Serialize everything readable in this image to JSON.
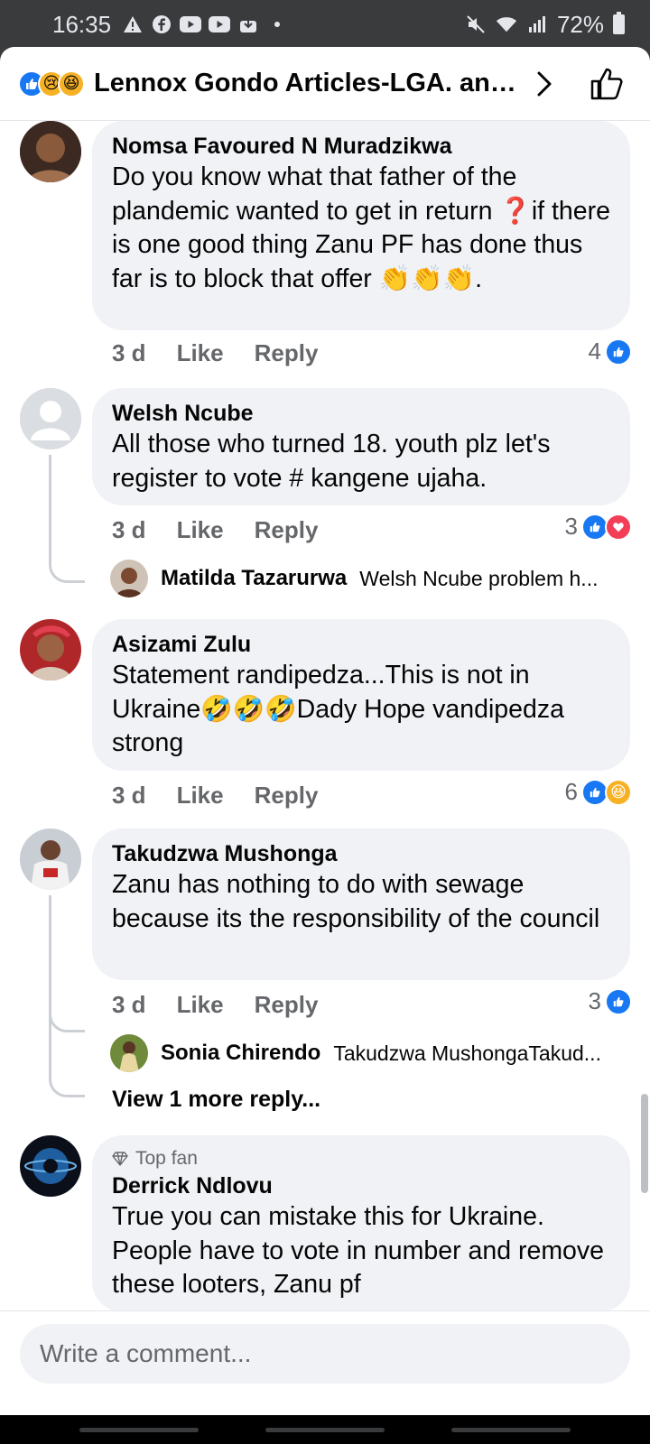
{
  "status": {
    "time": "16:35",
    "battery": "72%"
  },
  "header": {
    "title": "Lennox Gondo Articles-LGA. and..."
  },
  "comments": [
    {
      "author": "Nomsa Favoured N Muradzikwa",
      "text": "Do you know what that father  of  the plandemic  wanted to  get in return  ❓if there is one good  thing Zanu PF has done thus far is to block  that offer 👏👏👏.",
      "time": "3 d",
      "like": "Like",
      "reply": "Reply",
      "reactions": "4"
    },
    {
      "author": "Welsh Ncube",
      "text": "All those who turned 18. youth plz let's register to vote # kangene ujaha.",
      "time": "3 d",
      "like": "Like",
      "reply": "Reply",
      "reactions": "3",
      "reply_preview": {
        "author": "Matilda Tazarurwa",
        "snippet": "Welsh Ncube problem h..."
      }
    },
    {
      "author": "Asizami Zulu",
      "text": "Statement randipedza...This is not in Ukraine🤣🤣🤣Dady Hope vandipedza strong",
      "time": "3 d",
      "like": "Like",
      "reply": "Reply",
      "reactions": "6"
    },
    {
      "author": "Takudzwa Mushonga",
      "text": "Zanu has nothing to do with sewage because its the responsibility of the council",
      "time": "3 d",
      "like": "Like",
      "reply": "Reply",
      "reactions": "3",
      "reply_preview": {
        "author": "Sonia Chirendo",
        "snippet": "Takudzwa MushongaTakud..."
      },
      "view_more": "View 1 more reply..."
    },
    {
      "badge": "Top fan",
      "author": "Derrick Ndlovu",
      "text": "True you can mistake this for Ukraine. People have to vote in number and remove these looters, Zanu pf"
    }
  ],
  "composer": {
    "placeholder": "Write a comment..."
  },
  "colors": {
    "like_blue": "#1877f2",
    "love_red": "#f33e58",
    "bubble": "#f0f2f5",
    "meta_gray": "#65676b"
  }
}
